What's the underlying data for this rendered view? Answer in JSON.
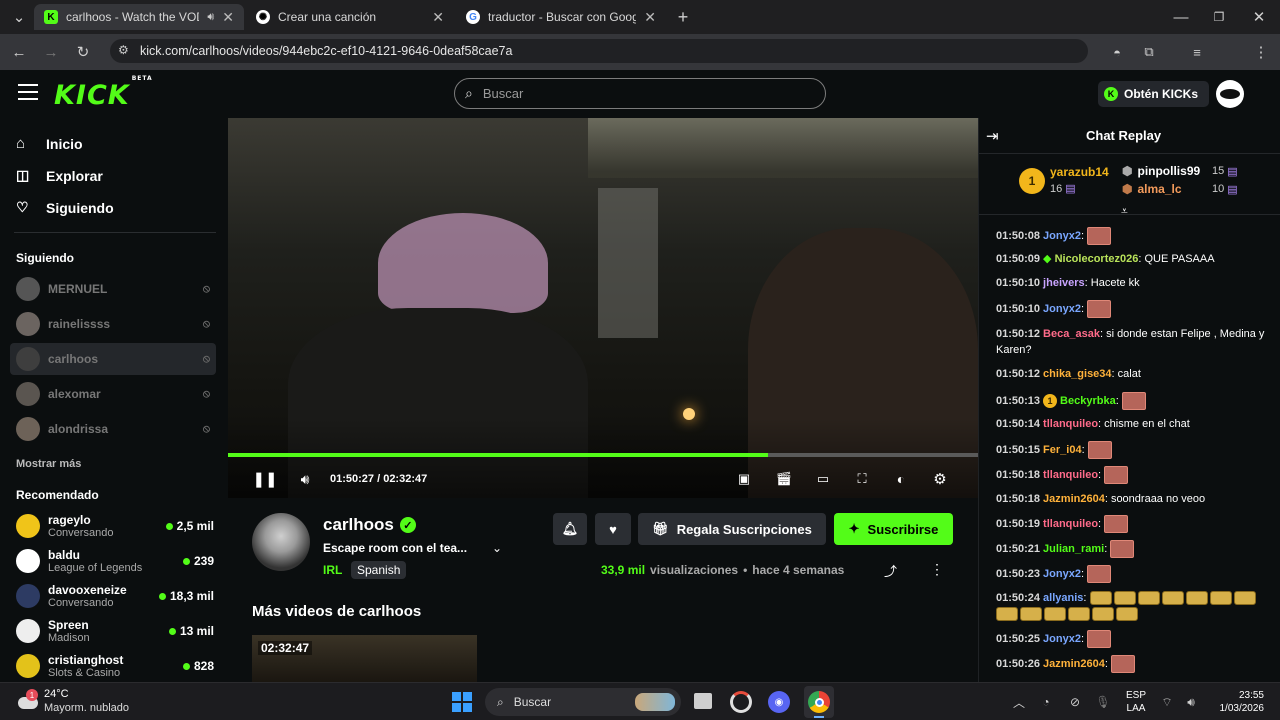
{
  "browser": {
    "tabs": [
      {
        "title": "carlhoos - Watch the VOD e",
        "favicon": "K",
        "active": true
      },
      {
        "title": "Crear una canción",
        "favicon": "chatgpt",
        "active": false
      },
      {
        "title": "traductor - Buscar con Google",
        "favicon": "G",
        "active": false
      }
    ],
    "url": "kick.com/carlhoos/videos/944ebc2c-ef10-4121-9646-0deaf58cae7a"
  },
  "header": {
    "logo": "KICK",
    "logo_badge": "BETA",
    "search_placeholder": "Buscar",
    "get_kicks": "Obtén KICKs"
  },
  "sidebar": {
    "nav": [
      {
        "label": "Inicio",
        "icon": "home-icon"
      },
      {
        "label": "Explorar",
        "icon": "compass-icon"
      },
      {
        "label": "Siguiendo",
        "icon": "heart-icon"
      }
    ],
    "following_title": "Siguiendo",
    "following": [
      {
        "name": "MERNUEL",
        "selected": false
      },
      {
        "name": "rainelissss",
        "selected": false
      },
      {
        "name": "carlhoos",
        "selected": true
      },
      {
        "name": "alexomar",
        "selected": false
      },
      {
        "name": "alondrissa",
        "selected": false
      }
    ],
    "show_more": "Mostrar más",
    "recommended_title": "Recomendado",
    "recommended": [
      {
        "name": "rageylo",
        "category": "Conversando",
        "viewers": "2,5 mil"
      },
      {
        "name": "baldu",
        "category": "League of Legends",
        "viewers": "239"
      },
      {
        "name": "davooxeneize",
        "category": "Conversando",
        "viewers": "18,3 mil"
      },
      {
        "name": "Spreen",
        "category": "Madison",
        "viewers": "13 mil"
      },
      {
        "name": "cristianghost",
        "category": "Slots & Casino",
        "viewers": "828"
      }
    ]
  },
  "player": {
    "current_time": "01:50:27",
    "duration": "02:32:47",
    "time_display": "01:50:27 / 02:32:47",
    "progress": 0.72
  },
  "channel": {
    "name": "carlhoos",
    "title": "Escape room con el tea...",
    "category": "IRL",
    "language": "Spanish",
    "gift_subs": "Regala Suscripciones",
    "subscribe": "Suscribirse",
    "views_count": "33,9 mil",
    "views_label": "visualizaciones",
    "age": "hace 4 semanas",
    "more_videos_title": "Más videos de carlhoos",
    "thumb_duration": "02:32:47"
  },
  "chat": {
    "title": "Chat Replay",
    "top": [
      {
        "rank": "1",
        "name": "yarazub14",
        "count": "16"
      },
      {
        "name": "pinpollis99",
        "count": "15"
      },
      {
        "name": "alma_lc",
        "count": "10"
      }
    ],
    "messages": [
      {
        "time": "01:50:08",
        "user": "Jonyx2",
        "color": "#7aa7ff",
        "text": "",
        "emotes": 1
      },
      {
        "time": "01:50:09",
        "user": "Nicolecortez026",
        "color": "#b9e35a",
        "text": "QUE PASAAA",
        "badge": "diamond"
      },
      {
        "time": "01:50:10",
        "user": "jheivers",
        "color": "#c9a4ff",
        "text": "Hacete kk"
      },
      {
        "time": "01:50:10",
        "user": "Jonyx2",
        "color": "#7aa7ff",
        "text": "",
        "emotes": 1
      },
      {
        "time": "01:50:12",
        "user": "Beca_asak",
        "color": "#ff6b8a",
        "text": "si donde estan Felipe , Medina y Karen?"
      },
      {
        "time": "01:50:12",
        "user": "chika_gise34",
        "color": "#ffb23b",
        "text": "calat"
      },
      {
        "time": "01:50:13",
        "user": "Beckyrbka",
        "color": "#53fc18",
        "text": "",
        "badge": "1",
        "emotes": 1
      },
      {
        "time": "01:50:14",
        "user": "tllanquileo",
        "color": "#ff6b8a",
        "text": "chisme en el chat"
      },
      {
        "time": "01:50:15",
        "user": "Fer_i04",
        "color": "#ffb23b",
        "text": "",
        "emotes": 1
      },
      {
        "time": "01:50:18",
        "user": "tllanquileo",
        "color": "#ff6b8a",
        "text": "",
        "emotes": 1
      },
      {
        "time": "01:50:18",
        "user": "Jazmin2604",
        "color": "#ffb23b",
        "text": "soondraaa no veoo"
      },
      {
        "time": "01:50:19",
        "user": "tllanquileo",
        "color": "#ff6b8a",
        "text": "",
        "emotes": 1
      },
      {
        "time": "01:50:21",
        "user": "Julian_rami",
        "color": "#53fc18",
        "text": "",
        "emotes": 1
      },
      {
        "time": "01:50:23",
        "user": "Jonyx2",
        "color": "#7aa7ff",
        "text": "",
        "emotes": 1
      },
      {
        "time": "01:50:24",
        "user": "allyanis",
        "color": "#7aa7ff",
        "text": "",
        "emotes": 13
      },
      {
        "time": "01:50:25",
        "user": "Jonyx2",
        "color": "#7aa7ff",
        "text": "",
        "emotes": 1
      },
      {
        "time": "01:50:26",
        "user": "Jazmin2604",
        "color": "#ffb23b",
        "text": "",
        "emotes": 1
      }
    ]
  },
  "taskbar": {
    "temp": "24°C",
    "weather": "Mayorm. nublado",
    "weather_badge": "1",
    "search": "Buscar",
    "lang": "ESP",
    "region": "LAA",
    "time": "23:55",
    "date": "1/03/2026"
  },
  "colors": {
    "accent": "#53fc18",
    "bg": "#0b0e0f",
    "panel": "#24272c"
  }
}
